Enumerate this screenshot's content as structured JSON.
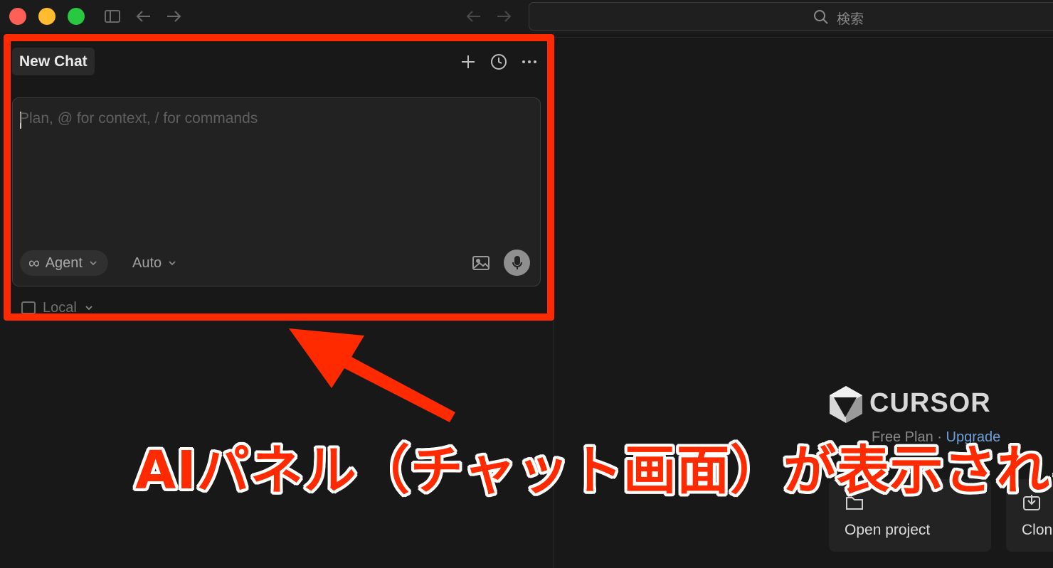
{
  "titlebar": {
    "search_label": "検索",
    "icons": [
      "sidebar-toggle-icon",
      "back-arrow-icon",
      "forward-arrow-icon",
      "search-icon"
    ]
  },
  "chat": {
    "tab_label": "New Chat",
    "composer_placeholder": "Plan, @ for context, / for commands",
    "mode_label": "Agent",
    "model_label": "Auto",
    "location_label": "Local"
  },
  "welcome": {
    "brand": "CURSOR",
    "plan_label": "Free Plan",
    "separator": "·",
    "upgrade_label": "Upgrade",
    "cards": [
      {
        "label": "Open project",
        "icon": "folder-icon"
      },
      {
        "label": "Clon",
        "icon": "clone-download-icon"
      }
    ]
  },
  "annotation": {
    "caption": "AIパネル（チャット画面）が表示される",
    "highlight_color": "#ff2a00"
  }
}
